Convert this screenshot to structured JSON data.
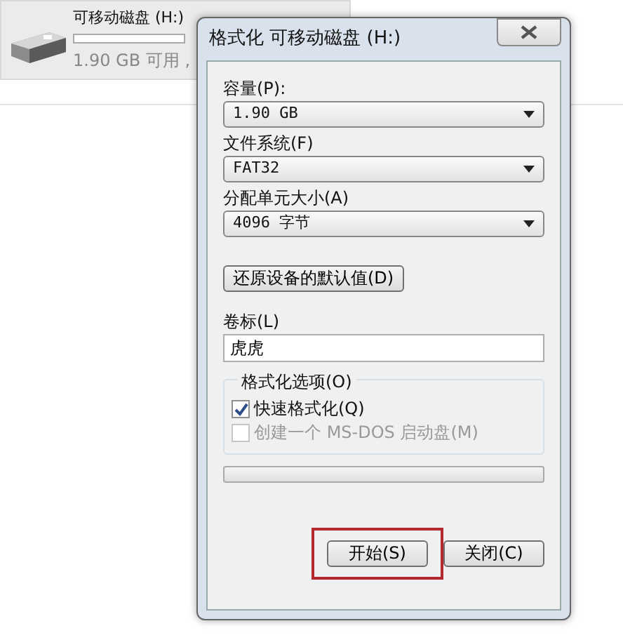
{
  "drive": {
    "name": "可移动磁盘 (H:)",
    "free": "1.90 GB 可用 ,"
  },
  "dialog": {
    "title": "格式化 可移动磁盘 (H:)",
    "fields": [
      {
        "label": "容量(P):",
        "value": "1.90 GB",
        "kind": "select"
      },
      {
        "label": "文件系统(F)",
        "value": "FAT32",
        "kind": "select"
      },
      {
        "label": "分配单元大小(A)",
        "value": "4096 字节",
        "kind": "select"
      }
    ],
    "restore_button": "还原设备的默认值(D)",
    "volume": {
      "label": "卷标(L)",
      "value": "虎虎"
    },
    "options": {
      "title": "格式化选项(O)",
      "items": [
        {
          "label": "快速格式化(Q)",
          "checked": true,
          "disabled": false
        },
        {
          "label": "创建一个 MS-DOS 启动盘(M)",
          "checked": false,
          "disabled": true
        }
      ]
    },
    "progress": {
      "level": 0
    },
    "buttons": [
      {
        "label": "开始(S)",
        "highlighted": true
      },
      {
        "label": "关闭(C)",
        "highlighted": false
      }
    ]
  }
}
